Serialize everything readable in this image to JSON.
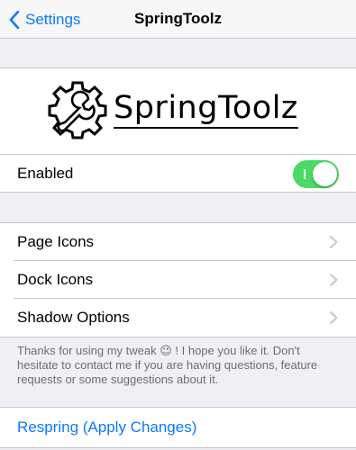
{
  "navbar": {
    "back_label": "Settings",
    "title": "SpringToolz"
  },
  "logo": {
    "icon": "gear-wrench-icon",
    "text": "SpringToolz"
  },
  "enabled": {
    "label": "Enabled",
    "value": true,
    "accent": "#4cd964"
  },
  "menu": {
    "items": [
      {
        "label": "Page Icons"
      },
      {
        "label": "Dock Icons"
      },
      {
        "label": "Shadow Options"
      }
    ]
  },
  "footer": {
    "text": "Thanks for using my tweak 😉 ! I hope you like it. Don't hesitate to contact me if you are having questions, feature requests or some suggestions about it."
  },
  "respring": {
    "label": "Respring (Apply Changes)"
  },
  "colors": {
    "tint": "#0a7aff",
    "background": "#efeff4",
    "separator": "#c8c7cc"
  }
}
